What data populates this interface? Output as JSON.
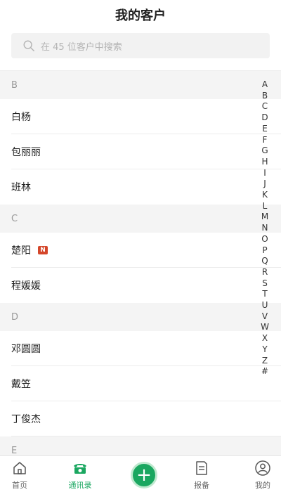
{
  "header": {
    "title": "我的客户",
    "search_placeholder": "在 45 位客户中搜索"
  },
  "sections": [
    {
      "letter": "B",
      "items": [
        {
          "name": "白杨"
        },
        {
          "name": "包丽丽"
        },
        {
          "name": "班林"
        }
      ]
    },
    {
      "letter": "C",
      "items": [
        {
          "name": "楚阳",
          "badge": "N"
        },
        {
          "name": "程媛媛"
        }
      ]
    },
    {
      "letter": "D",
      "items": [
        {
          "name": "邓圆圆"
        },
        {
          "name": "戴笠"
        },
        {
          "name": "丁俊杰"
        }
      ]
    },
    {
      "letter": "E",
      "items": []
    }
  ],
  "index_letters": [
    "A",
    "B",
    "C",
    "D",
    "E",
    "F",
    "G",
    "H",
    "I",
    "J",
    "K",
    "L",
    "M",
    "N",
    "O",
    "P",
    "Q",
    "R",
    "S",
    "T",
    "U",
    "V",
    "W",
    "X",
    "Y",
    "Z",
    "#"
  ],
  "tabbar": {
    "home": "首页",
    "contacts": "通讯录",
    "report": "报备",
    "mine": "我的"
  },
  "colors": {
    "accent": "#1aa760",
    "badge": "#d4462a"
  }
}
